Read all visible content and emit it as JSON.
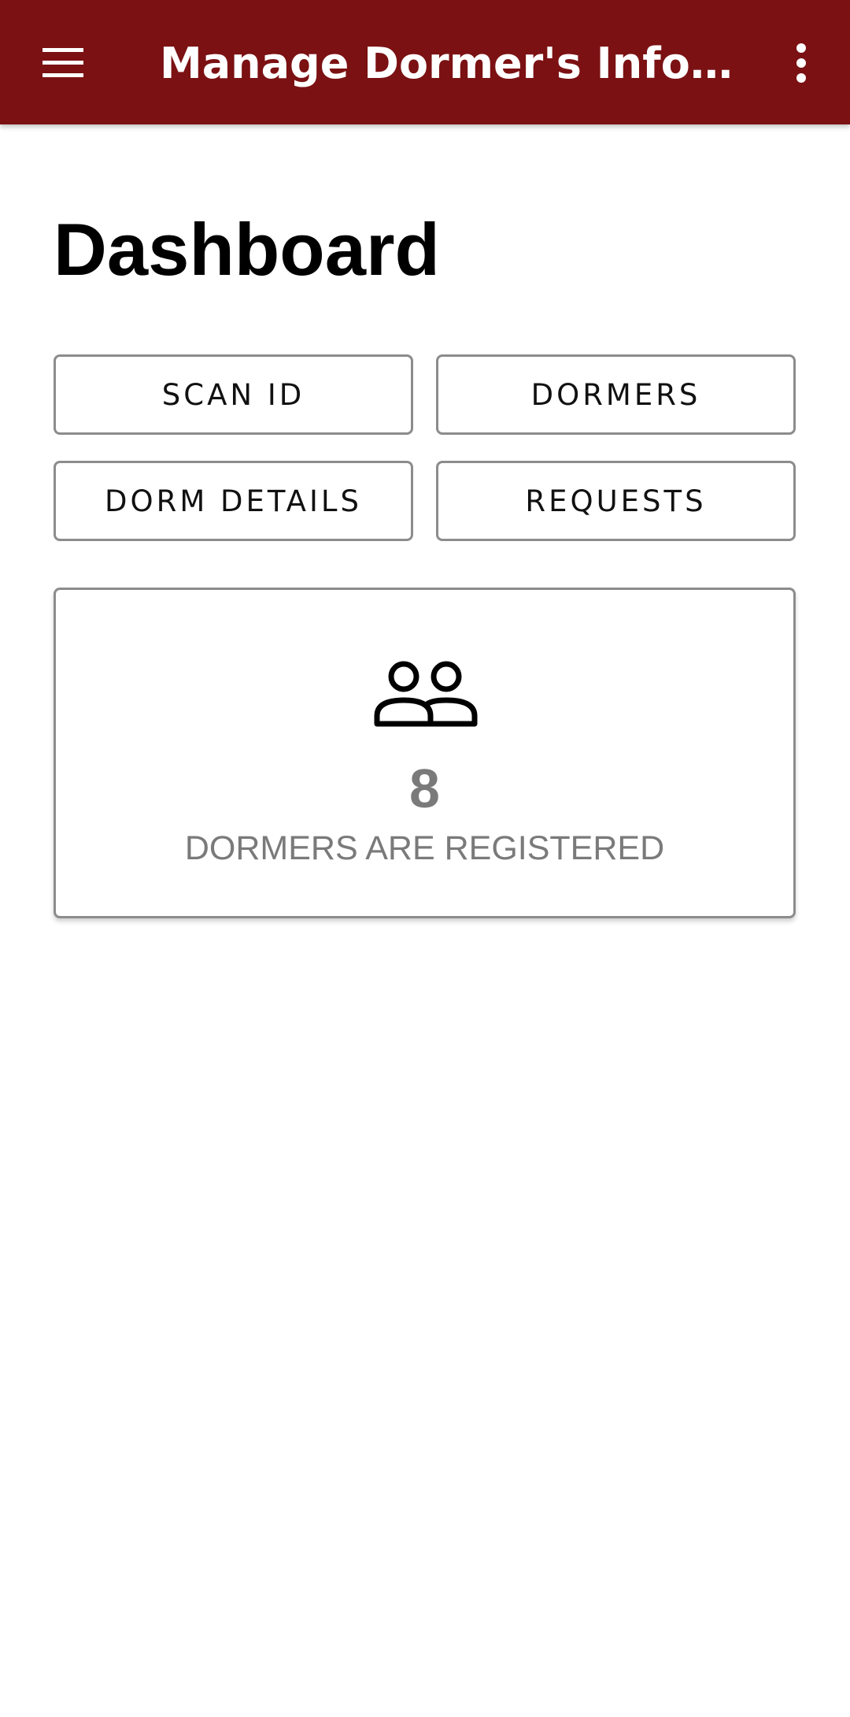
{
  "appbar": {
    "title": "Manage Dormer's Information",
    "menu_icon": "hamburger-menu-icon",
    "overflow_icon": "more-vertical-icon",
    "color": "#7b1113"
  },
  "page": {
    "title": "Dashboard"
  },
  "actions": {
    "scan_id": "SCAN ID",
    "dormers": "DORMERS",
    "dorm_details": "DORM DETAILS",
    "requests": "REQUESTS"
  },
  "stats": {
    "icon": "people-icon",
    "count": "8",
    "label": "DORMERS ARE REGISTERED"
  }
}
